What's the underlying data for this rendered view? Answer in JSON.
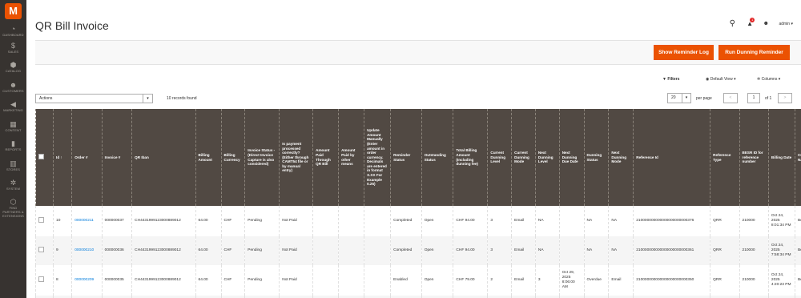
{
  "sidebar": {
    "logo": "M",
    "items": [
      {
        "icon": "dashboard-icon",
        "glyph": "◔",
        "label": "DASHBOARD"
      },
      {
        "icon": "dollar-icon",
        "glyph": "$",
        "label": "SALES"
      },
      {
        "icon": "cube-icon",
        "glyph": "⬢",
        "label": "CATALOG"
      },
      {
        "icon": "person-icon",
        "glyph": "☻",
        "label": "CUSTOMERS"
      },
      {
        "icon": "megaphone-icon",
        "glyph": "◀",
        "label": "MARKETING"
      },
      {
        "icon": "content-icon",
        "glyph": "▦",
        "label": "CONTENT"
      },
      {
        "icon": "bar-chart-icon",
        "glyph": "▮",
        "label": "REPORTS"
      },
      {
        "icon": "store-icon",
        "glyph": "▥",
        "label": "STORES"
      },
      {
        "icon": "gear-icon",
        "glyph": "✲",
        "label": "SYSTEM"
      },
      {
        "icon": "extensions-icon",
        "glyph": "⬡",
        "label": "FIND PARTNERS & EXTENSIONS"
      }
    ]
  },
  "header": {
    "title": "QR Bill Invoice",
    "search_glyph": "⚲",
    "notification_count": "1",
    "user": "admin ▾"
  },
  "actions_bar": {
    "show_reminder_log": "Show Reminder Log",
    "run_dunning_reminder": "Run Dunning Reminder"
  },
  "toolbar": {
    "filters": "Filters",
    "default_view": "Default View",
    "columns": "Columns",
    "actions": "Actions",
    "records_found": "10 records found",
    "per_page_value": "20",
    "per_page_label": "per page",
    "page_current": "1",
    "page_of": "of 1",
    "prev": "<",
    "next": ">"
  },
  "table": {
    "columns": [
      "",
      "Id ↑",
      "Order #",
      "Invoice #",
      "QR Iban",
      "Billing Amount",
      "Billing Currency",
      "Invoice Status - (Direct Invoice Capture is also considered)",
      "Is payment processed correctly? (Either through CAMT54 file or by manual entry)",
      "Amount Paid Through QR Bill",
      "Amount Paid by other means",
      "Update Amount Manually (Enter amount in order currency. Decimals are entered in format X.XX For Example 0.25)",
      "Reminder Status",
      "Outstanding Status",
      "Total Billing Amount (Including dunning fee)",
      "Current Dunning Level",
      "Current Dunning Mode",
      "Next Dunning Level",
      "Next Dunning Due Date",
      "Dunning Status",
      "Next Dunning Mode",
      "Reference Id",
      "Reference Type",
      "BESR ID for reference number",
      "Billing Date",
      "Customer Name",
      "Customer Email"
    ],
    "rows": [
      [
        "",
        "10",
        "000000211",
        "000000037",
        "CH4431999123000889012",
        "64.00",
        "CHF",
        "Pending",
        "Not Paid",
        "",
        "",
        "",
        "Completed",
        "Open",
        "CHF 94.00",
        "3",
        "Email",
        "NA",
        "",
        "NA",
        "NA",
        "210000000000000000000000376",
        "QRR",
        "210000",
        "Oct 24, 2025 8:01:34 PM",
        "Benz Schulze",
        "benzschulze85@gm"
      ],
      [
        "",
        "9",
        "000000210",
        "000000036",
        "CH4431999123000889012",
        "64.00",
        "CHF",
        "Pending",
        "Not Paid",
        "",
        "",
        "",
        "Completed",
        "Open",
        "CHF 94.00",
        "3",
        "Email",
        "NA",
        "",
        "NA",
        "NA",
        "210000000000000000000000361",
        "QRR",
        "210000",
        "Oct 24, 2025 7:58:34 PM",
        "Benz Schulze",
        "benzschulze85@gm"
      ],
      [
        "",
        "8",
        "000000209",
        "000000035",
        "CH4431999123000889012",
        "64.00",
        "CHF",
        "Pending",
        "Not Paid",
        "",
        "",
        "",
        "Enabled",
        "Open",
        "CHF 79.00",
        "2",
        "Email",
        "3",
        "Oct 29, 2025 8:06:00 AM",
        "Overdue",
        "Email",
        "210000000000000000000000350",
        "QRR",
        "210000",
        "Oct 24, 2025 4:20:23 PM",
        "Benz Schulze",
        "benzschulze85@gm"
      ],
      [
        "",
        "",
        "",
        "",
        "",
        "",
        "",
        "",
        "",
        "",
        "",
        "",
        "",
        "",
        "",
        "",
        "",
        "",
        "",
        "",
        "",
        "",
        "",
        "",
        "Oct 24,",
        "",
        ""
      ]
    ]
  },
  "colors": {
    "accent": "#eb5202",
    "sidebar": "#373330",
    "header_row": "#514943",
    "link": "#007bdb"
  }
}
